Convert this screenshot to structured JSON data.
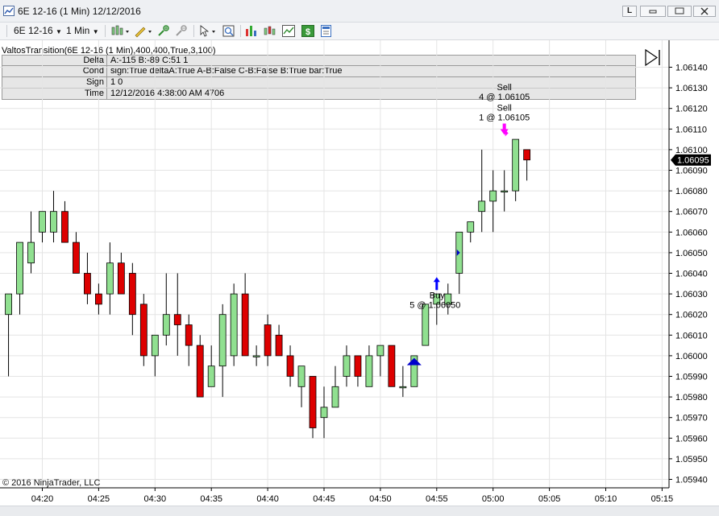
{
  "window": {
    "title": "6E 12-16 (1 Min)  12/12/2016",
    "buttons": [
      "L",
      "▭",
      "▢",
      "✕"
    ]
  },
  "toolbar": {
    "instrument": "6E 12-16",
    "interval": "1 Min"
  },
  "indicator": {
    "title": "ValtosTransition(6E 12-16 (1 Min),400,400,True,3,100)",
    "rows": [
      {
        "label": "Delta",
        "value": "A:-115 B:-89 C:51 1"
      },
      {
        "label": "Cond",
        "value": "sign:True deltaA:True A-B:False C-B:False B:True bar:True"
      },
      {
        "label": "Sign",
        "value": "1 0"
      },
      {
        "label": "Time",
        "value": "12/12/2016 4:38:00 AM 4706"
      }
    ]
  },
  "copyright": "© 2016 NinjaTrader, LLC",
  "chart_data": {
    "type": "candlestick",
    "up_color": "#90e090",
    "down_color": "#dd0000",
    "ylim": [
      1.05935,
      1.06145
    ],
    "price_ticks": [
      "1.06140",
      "1.06130",
      "1.06120",
      "1.06110",
      "1.06100",
      "1.06090",
      "1.06080",
      "1.06070",
      "1.06060",
      "1.06050",
      "1.06040",
      "1.06030",
      "1.06020",
      "1.06010",
      "1.06000",
      "1.05990",
      "1.05980",
      "1.05970",
      "1.05960",
      "1.05950",
      "1.05940"
    ],
    "time_ticks": [
      "04:20",
      "04:25",
      "04:30",
      "04:35",
      "04:40",
      "04:45",
      "04:50",
      "04:55",
      "05:00",
      "05:05",
      "05:10",
      "05:15"
    ],
    "last_price": "1.06095",
    "candles": [
      {
        "t": "04:17",
        "o": 1.0602,
        "h": 1.0603,
        "l": 1.0599,
        "c": 1.0603
      },
      {
        "t": "04:18",
        "o": 1.0603,
        "h": 1.06055,
        "l": 1.0602,
        "c": 1.06055
      },
      {
        "t": "04:19",
        "o": 1.06045,
        "h": 1.0607,
        "l": 1.0604,
        "c": 1.06055
      },
      {
        "t": "04:20",
        "o": 1.0606,
        "h": 1.0607,
        "l": 1.06055,
        "c": 1.0607
      },
      {
        "t": "04:21",
        "o": 1.0606,
        "h": 1.0608,
        "l": 1.06055,
        "c": 1.0607
      },
      {
        "t": "04:22",
        "o": 1.0607,
        "h": 1.06075,
        "l": 1.06055,
        "c": 1.06055
      },
      {
        "t": "04:23",
        "o": 1.06055,
        "h": 1.0606,
        "l": 1.0604,
        "c": 1.0604
      },
      {
        "t": "04:24",
        "o": 1.0604,
        "h": 1.0605,
        "l": 1.06025,
        "c": 1.0603
      },
      {
        "t": "04:25",
        "o": 1.0603,
        "h": 1.06035,
        "l": 1.0602,
        "c": 1.06025
      },
      {
        "t": "04:26",
        "o": 1.0603,
        "h": 1.06055,
        "l": 1.0602,
        "c": 1.06045
      },
      {
        "t": "04:27",
        "o": 1.06045,
        "h": 1.0605,
        "l": 1.0603,
        "c": 1.0603
      },
      {
        "t": "04:28",
        "o": 1.0604,
        "h": 1.06045,
        "l": 1.0601,
        "c": 1.0602
      },
      {
        "t": "04:29",
        "o": 1.06025,
        "h": 1.0603,
        "l": 1.05995,
        "c": 1.06
      },
      {
        "t": "04:30",
        "o": 1.06,
        "h": 1.0601,
        "l": 1.0599,
        "c": 1.0601
      },
      {
        "t": "04:31",
        "o": 1.0601,
        "h": 1.0604,
        "l": 1.06005,
        "c": 1.0602
      },
      {
        "t": "04:32",
        "o": 1.0602,
        "h": 1.0604,
        "l": 1.06,
        "c": 1.06015
      },
      {
        "t": "04:33",
        "o": 1.06015,
        "h": 1.0602,
        "l": 1.05995,
        "c": 1.06005
      },
      {
        "t": "04:34",
        "o": 1.06005,
        "h": 1.0601,
        "l": 1.0598,
        "c": 1.0598
      },
      {
        "t": "04:35",
        "o": 1.05985,
        "h": 1.06005,
        "l": 1.05985,
        "c": 1.05995
      },
      {
        "t": "04:36",
        "o": 1.05995,
        "h": 1.06025,
        "l": 1.0598,
        "c": 1.0602
      },
      {
        "t": "04:37",
        "o": 1.06,
        "h": 1.06035,
        "l": 1.05995,
        "c": 1.0603
      },
      {
        "t": "04:38",
        "o": 1.0603,
        "h": 1.0604,
        "l": 1.06,
        "c": 1.06
      },
      {
        "t": "04:39",
        "o": 1.06,
        "h": 1.06005,
        "l": 1.05995,
        "c": 1.06
      },
      {
        "t": "04:40",
        "o": 1.06015,
        "h": 1.0602,
        "l": 1.05995,
        "c": 1.06
      },
      {
        "t": "04:41",
        "o": 1.0601,
        "h": 1.06015,
        "l": 1.06,
        "c": 1.06
      },
      {
        "t": "04:42",
        "o": 1.06,
        "h": 1.06005,
        "l": 1.05985,
        "c": 1.0599
      },
      {
        "t": "04:43",
        "o": 1.05985,
        "h": 1.05995,
        "l": 1.05975,
        "c": 1.05995
      },
      {
        "t": "04:44",
        "o": 1.0599,
        "h": 1.0599,
        "l": 1.0596,
        "c": 1.05965
      },
      {
        "t": "04:45",
        "o": 1.0597,
        "h": 1.05985,
        "l": 1.0596,
        "c": 1.05975
      },
      {
        "t": "04:46",
        "o": 1.05975,
        "h": 1.05995,
        "l": 1.05975,
        "c": 1.05985
      },
      {
        "t": "04:47",
        "o": 1.0599,
        "h": 1.06005,
        "l": 1.05985,
        "c": 1.06
      },
      {
        "t": "04:48",
        "o": 1.06,
        "h": 1.06,
        "l": 1.05985,
        "c": 1.0599
      },
      {
        "t": "04:49",
        "o": 1.05985,
        "h": 1.06005,
        "l": 1.05985,
        "c": 1.06
      },
      {
        "t": "04:50",
        "o": 1.06,
        "h": 1.06005,
        "l": 1.0599,
        "c": 1.06005
      },
      {
        "t": "04:51",
        "o": 1.06005,
        "h": 1.06005,
        "l": 1.05985,
        "c": 1.05985
      },
      {
        "t": "04:52",
        "o": 1.05985,
        "h": 1.05995,
        "l": 1.0598,
        "c": 1.05985
      },
      {
        "t": "04:53",
        "o": 1.05985,
        "h": 1.06,
        "l": 1.05985,
        "c": 1.06
      },
      {
        "t": "04:54",
        "o": 1.06005,
        "h": 1.06025,
        "l": 1.06005,
        "c": 1.06025
      },
      {
        "t": "04:55",
        "o": 1.06025,
        "h": 1.0603,
        "l": 1.06015,
        "c": 1.0603
      },
      {
        "t": "04:56",
        "o": 1.06025,
        "h": 1.06035,
        "l": 1.0602,
        "c": 1.0603
      },
      {
        "t": "04:57",
        "o": 1.0604,
        "h": 1.0606,
        "l": 1.0603,
        "c": 1.0606
      },
      {
        "t": "04:58",
        "o": 1.0606,
        "h": 1.06065,
        "l": 1.06055,
        "c": 1.06065
      },
      {
        "t": "04:59",
        "o": 1.0607,
        "h": 1.061,
        "l": 1.0606,
        "c": 1.06075
      },
      {
        "t": "05:00",
        "o": 1.06075,
        "h": 1.0609,
        "l": 1.0606,
        "c": 1.0608
      },
      {
        "t": "05:01",
        "o": 1.0608,
        "h": 1.0609,
        "l": 1.0607,
        "c": 1.0608
      },
      {
        "t": "05:02",
        "o": 1.0608,
        "h": 1.06105,
        "l": 1.06075,
        "c": 1.06105
      },
      {
        "t": "05:03",
        "o": 1.061,
        "h": 1.061,
        "l": 1.06085,
        "c": 1.06095
      }
    ],
    "annotations": [
      {
        "kind": "buy",
        "label": "Buy",
        "detail": "5 @ 1.06050",
        "at_candle": 38,
        "price": 1.06035,
        "color": "#0000ff"
      },
      {
        "kind": "sell",
        "label": "Sell",
        "detail": "4 @ 1.06105",
        "at_candle": 44,
        "price": 1.06125,
        "color": "#000000"
      },
      {
        "kind": "sell",
        "label": "Sell",
        "detail": "1 @ 1.06105",
        "at_candle": 44,
        "price": 1.06115,
        "color": "#ff00ff"
      }
    ],
    "markers": [
      {
        "kind": "triangle-up",
        "at_candle": 36,
        "price": 1.05997,
        "color": "#0000cc"
      },
      {
        "kind": "triangle-right",
        "at_candle": 40,
        "price": 1.0605,
        "color": "#0000cc"
      },
      {
        "kind": "triangle-small",
        "at_candle": 44,
        "price": 1.06108,
        "color": "#ff00ff"
      }
    ]
  }
}
